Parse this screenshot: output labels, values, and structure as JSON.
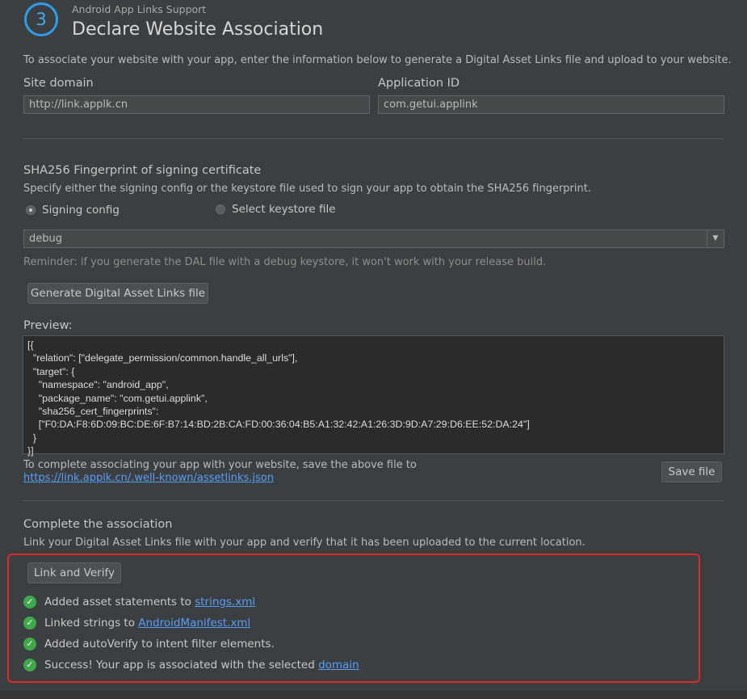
{
  "header": {
    "step_number": "3",
    "subtitle": "Android App Links Support",
    "title": "Declare Website Association"
  },
  "intro": "To associate your website with your app, enter the information below to generate a Digital Asset Links file and upload to your website.",
  "site_domain": {
    "label": "Site domain",
    "value": "http://link.applk.cn"
  },
  "application_id": {
    "label": "Application ID",
    "value": "com.getui.applink"
  },
  "sha": {
    "heading": "SHA256 Fingerprint of signing certificate",
    "description": "Specify either the signing config or the keystore file used to sign your app to obtain the SHA256 fingerprint.",
    "radio_signing": "Signing config",
    "radio_keystore": "Select keystore file",
    "selected": "signing",
    "config_value": "debug",
    "reminder": "Reminder: if you generate the DAL file with a debug keystore, it won't work with your release build."
  },
  "generate_button": "Generate Digital Asset Links file",
  "preview": {
    "label": "Preview:",
    "content": "[{\n  \"relation\": [\"delegate_permission/common.handle_all_urls\"],\n  \"target\": {\n    \"namespace\": \"android_app\",\n    \"package_name\": \"com.getui.applink\",\n    \"sha256_cert_fingerprints\":\n    [\"F0:DA:F8:6D:09:BC:DE:6F:B7:14:BD:2B:CA:FD:00:36:04:B5:A1:32:42:A1:26:3D:9D:A7:29:D6:EE:52:DA:24\"]\n  }\n}]"
  },
  "save": {
    "text": "To complete associating your app with your website, save the above file to",
    "link": "https://link.applk.cn/.well-known/assetlinks.json",
    "button": "Save file"
  },
  "association": {
    "heading": "Complete the association",
    "description": "Link your Digital Asset Links file with your app and verify that it has been uploaded to the current location.",
    "button": "Link and Verify",
    "results": [
      {
        "text": "Added asset statements to ",
        "link": "strings.xml",
        "icon": "check-circle-icon"
      },
      {
        "text": "Linked strings to ",
        "link": "AndroidManifest.xml",
        "icon": "check-circle-icon"
      },
      {
        "text": "Added autoVerify to intent filter elements.",
        "link": "",
        "icon": "check-circle-icon"
      },
      {
        "text": "Success! Your app is associated with the selected ",
        "link": "domain",
        "icon": "check-circle-icon"
      }
    ]
  },
  "colors": {
    "background": "#3c3f41",
    "accent": "#2f9de8",
    "link": "#589df6",
    "success": "#3ea84a",
    "highlight_border": "#e0292a"
  }
}
